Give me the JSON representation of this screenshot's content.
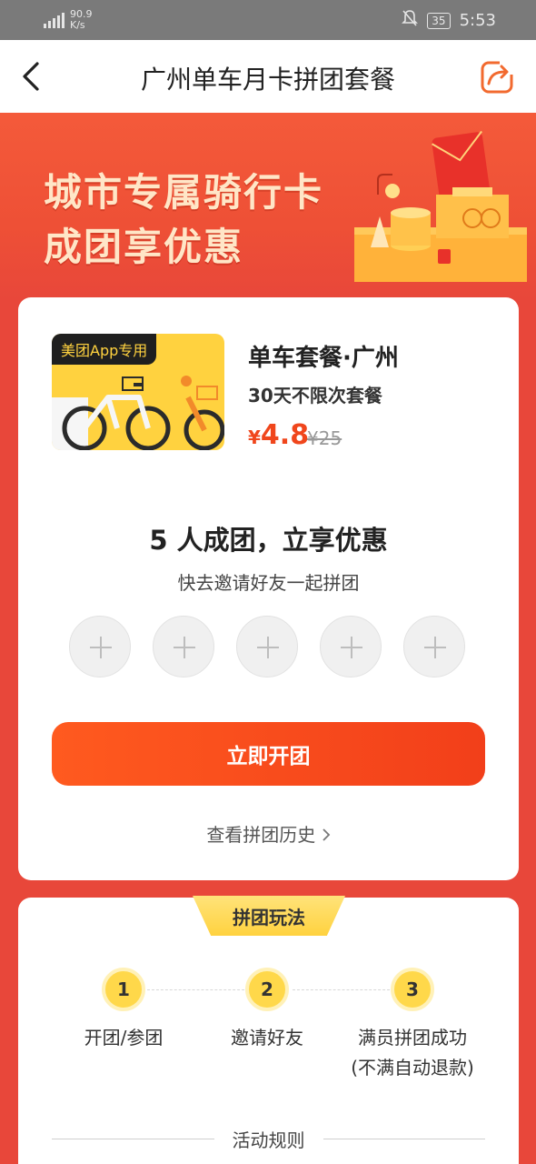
{
  "status_bar": {
    "net_speed_value": "90.9",
    "net_speed_unit": "K/s",
    "battery": "35",
    "time": "5:53"
  },
  "nav": {
    "title": "广州单车月卡拼团套餐"
  },
  "banner": {
    "line1": "城市专属骑行卡",
    "line2": "成团享优惠"
  },
  "product": {
    "tag": "美团App专用",
    "title": "单车套餐·广州",
    "subtitle": "30天不限次套餐",
    "currency": "¥",
    "price": "4.8",
    "original_price": "¥25"
  },
  "group": {
    "title": "5 人成团，立享优惠",
    "subtitle": "快去邀请好友一起拼团",
    "slots": 5,
    "start_button": "立即开团",
    "history_link": "查看拼团历史"
  },
  "rules": {
    "tab_label": "拼团玩法",
    "steps": [
      {
        "number": "1",
        "label": "开团/参团",
        "note": ""
      },
      {
        "number": "2",
        "label": "邀请好友",
        "note": ""
      },
      {
        "number": "3",
        "label": "满员拼团成功",
        "note": "(不满自动退款)"
      }
    ],
    "footer_label": "活动规则"
  },
  "colors": {
    "page_red": "#e8473a",
    "price_orange": "#f0461c",
    "button_orange": "#ff5a1f",
    "step_yellow": "#ffd84a",
    "share_orange": "#f26a2f"
  }
}
